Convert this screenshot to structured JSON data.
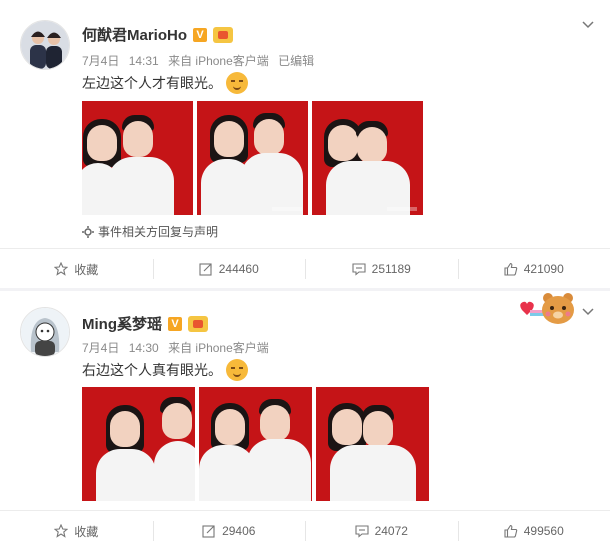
{
  "posts": [
    {
      "author": "何猷君MarioHo",
      "verified_badge": "V",
      "date": "7月4日",
      "time": "14:31",
      "source": "来自 iPhone客户端",
      "edited": "已编辑",
      "text": "左边这个人才有眼光。",
      "emoji_icon": "smirk-emoji-icon",
      "event_link": "事件相关方回复与声明",
      "actions": {
        "favorite": "收藏",
        "repost": "244460",
        "comment": "251189",
        "like": "421090"
      }
    },
    {
      "author": "Ming奚梦瑶",
      "verified_badge": "V",
      "date": "7月4日",
      "time": "14:30",
      "source": "来自 iPhone客户端",
      "text": "右边这个人真有眼光。",
      "emoji_icon": "smile-emoji-icon",
      "actions": {
        "favorite": "收藏",
        "repost": "29406",
        "comment": "24072",
        "like": "499560"
      }
    }
  ],
  "colors": {
    "photo_background": "#c51417",
    "text_primary": "#333333",
    "text_meta": "#8a8a8a",
    "verified_badge": "#f6a623",
    "page_background": "#f2f2f5"
  }
}
